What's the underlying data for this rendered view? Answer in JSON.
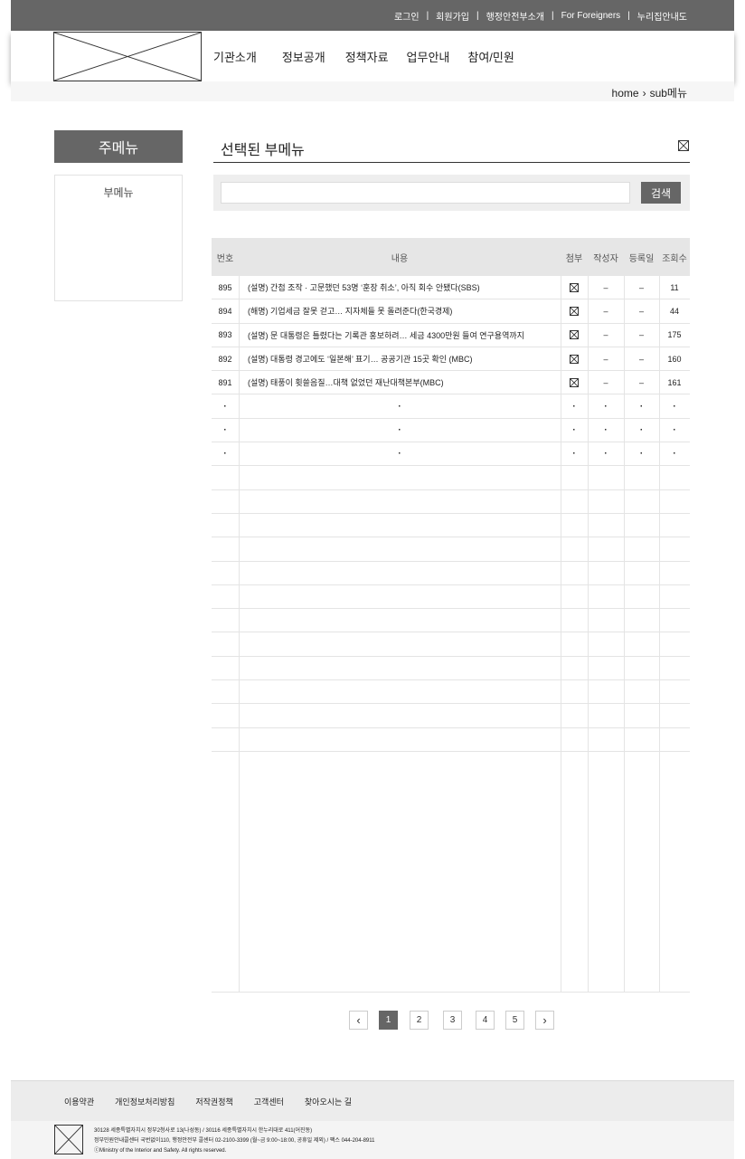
{
  "top_links": [
    "로그인",
    "회원가입",
    "행정안전부소개",
    "For Foreigners",
    "누리집안내도"
  ],
  "nav": [
    "기관소개",
    "정보공개",
    "정책자료",
    "업무안내",
    "참여/민원"
  ],
  "breadcrumb": {
    "home": "home",
    "current": "sub메뉴"
  },
  "sidebar": {
    "title": "주메뉴",
    "item": "부메뉴"
  },
  "content": {
    "title": "선택된 부메뉴"
  },
  "search": {
    "value": "",
    "button": "검색"
  },
  "table": {
    "headers": {
      "no": "번호",
      "title": "내용",
      "file": "첨부",
      "author": "작성자",
      "date": "등록일",
      "views": "조회수"
    },
    "rows": [
      {
        "no": "895",
        "title": "(설명) 간첩 조작 · 고문했던 53명 ‘훈장 취소’, 아직 회수 안됐다(SBS)",
        "author": "–",
        "date": "–",
        "views": "11"
      },
      {
        "no": "894",
        "title": "(해명) 기업세금 잘못 걷고… 지자체들 못 돌려준다(한국경제)",
        "author": "–",
        "date": "–",
        "views": "44"
      },
      {
        "no": "893",
        "title": "(설명) 문 대통령은 틀렸다는 기록관 홍보하려… 세금 4300만원 들여 연구용역까지",
        "author": "–",
        "date": "–",
        "views": "175"
      },
      {
        "no": "892",
        "title": "(설명) 대통령 경고에도 ‘일본해’ 표기… 공공기관 15곳 확인 (MBC)",
        "author": "–",
        "date": "–",
        "views": "160"
      },
      {
        "no": "891",
        "title": "(설명) 태풍이 휫쓸음질…대책 없었던 재난대책본부(MBC)",
        "author": "–",
        "date": "–",
        "views": "161"
      }
    ],
    "ellipsis": "·"
  },
  "pagination": {
    "prev": "‹",
    "pages": [
      "1",
      "2",
      "3",
      "4",
      "5"
    ],
    "current": "1",
    "next": "›"
  },
  "footer": {
    "links": [
      "이용약관",
      "개인정보처리방침",
      "저작권정책",
      "고객센터",
      "찾아오시는 길"
    ],
    "address": "30128 세종특별자치시 정부2청사로 13(나성동) / 30116 세종특별자치시 한누리대로 411(어진동)",
    "contact": "정부민원안내콜센터 국번없이110, 행정안전부 콜센터 02-2100-3399 (월~금 9:00~18:00, 공휴일 제외) / 팩스 044-204-8911",
    "copyright": "ⓒMinistry of the Interior and Safety. All rights reserved."
  },
  "colors": {
    "bar": "#666666",
    "header_bg": "#ffffff",
    "table_head": "#e6e6e6",
    "footer_bg": "#ececec"
  }
}
